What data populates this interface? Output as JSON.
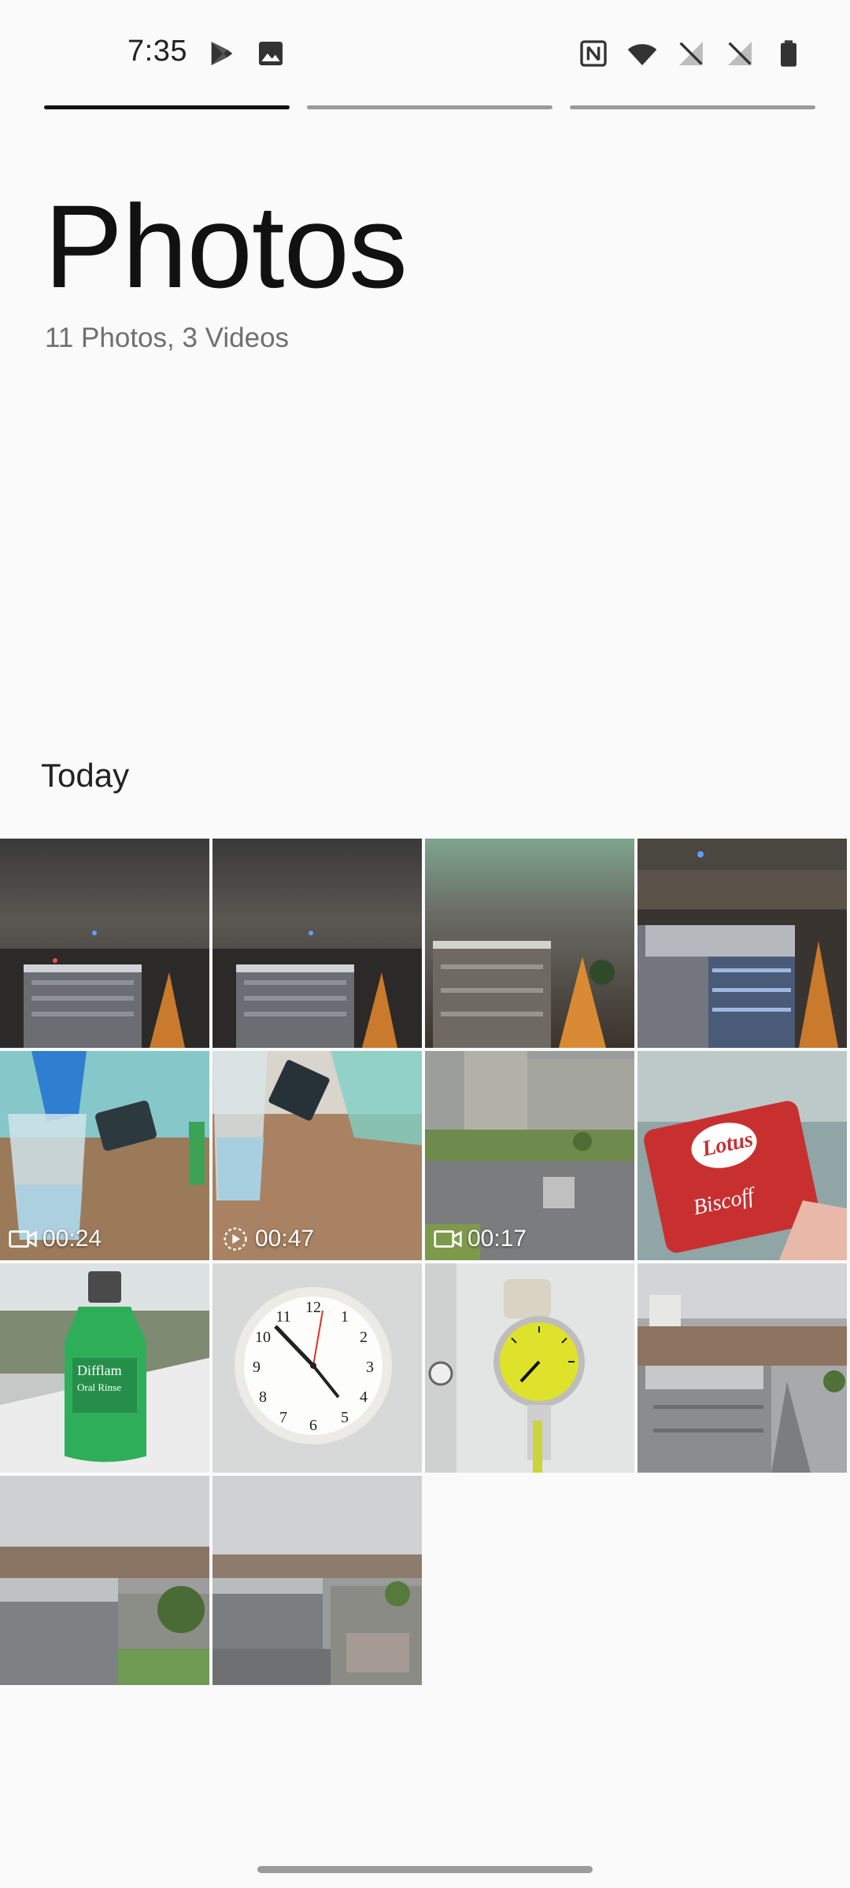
{
  "status_bar": {
    "time": "7:35",
    "left_icons": [
      "play-store-icon",
      "image-icon"
    ],
    "right_icons": [
      "nfc-icon",
      "wifi-icon",
      "no-sim-icon",
      "no-sim-icon",
      "battery-icon"
    ]
  },
  "progress": {
    "segments": [
      {
        "state": "active",
        "fill": 1.0
      },
      {
        "state": "pending",
        "fill": 0
      },
      {
        "state": "pending",
        "fill": 0
      }
    ]
  },
  "header": {
    "title": "Photos",
    "subtitle": "11 Photos, 3 Videos"
  },
  "section": {
    "label": "Today"
  },
  "grid": {
    "items": [
      {
        "kind": "photo",
        "scene": "night-city"
      },
      {
        "kind": "photo",
        "scene": "night-city"
      },
      {
        "kind": "photo",
        "scene": "night-city-reflection"
      },
      {
        "kind": "photo",
        "scene": "night-rooftop"
      },
      {
        "kind": "video",
        "scene": "water-glass",
        "duration": "00:24",
        "badge_icon": "video-camera-icon"
      },
      {
        "kind": "video",
        "scene": "water-glass-2",
        "duration": "00:47",
        "badge_icon": "motion-photo-icon"
      },
      {
        "kind": "video",
        "scene": "building-crossing",
        "duration": "00:17",
        "badge_icon": "video-camera-icon"
      },
      {
        "kind": "photo",
        "scene": "biscuit",
        "caption": "Lotus Biscoff"
      },
      {
        "kind": "photo",
        "scene": "green-bottle",
        "caption": "Difflam Oral Rinse"
      },
      {
        "kind": "photo",
        "scene": "wall-clock"
      },
      {
        "kind": "photo",
        "scene": "pressure-gauge"
      },
      {
        "kind": "photo",
        "scene": "city-day"
      },
      {
        "kind": "photo",
        "scene": "city-day-2"
      },
      {
        "kind": "photo",
        "scene": "city-day-3"
      }
    ]
  },
  "colors": {
    "background": "#fafafa",
    "text": "#111111",
    "subtext": "#6f6f6f",
    "progress_inactive": "#9a9a9a",
    "progress_active": "#111111"
  }
}
